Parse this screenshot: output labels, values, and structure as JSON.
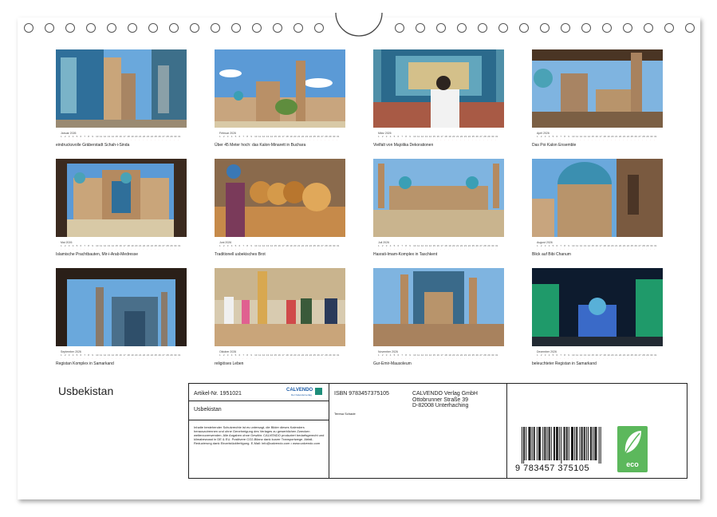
{
  "calendar_title": "Usbekistan",
  "months": [
    {
      "name": "Januar 2026",
      "caption": "eindrucksvolle Gräberstadt Schah-i-Sinda"
    },
    {
      "name": "Februar 2026",
      "caption": "Über 45 Meter hoch: das Kalon-Minarett in Buchara"
    },
    {
      "name": "März 2026",
      "caption": "Vielfalt von Majolika Dekorationen"
    },
    {
      "name": "April 2026",
      "caption": "Das Poi Kalon Ensemble"
    },
    {
      "name": "Mai 2026",
      "caption": "Islamische Prachtbauten, Mir-i-Arab-Medresse"
    },
    {
      "name": "Juni 2026",
      "caption": "Traditionell usbekisches Brot"
    },
    {
      "name": "Juli 2026",
      "caption": "Hasrati-Imam-Komplex in Taschkent"
    },
    {
      "name": "August 2026",
      "caption": "Blick auf Bibi Chanum"
    },
    {
      "name": "September 2026",
      "caption": "Registan Komplex in Samarkand"
    },
    {
      "name": "Oktober 2026",
      "caption": "religiöses Leben"
    },
    {
      "name": "November 2026",
      "caption": "Gur-Emir-Mausoleum"
    },
    {
      "name": "Dezember 2026",
      "caption": "beleuchteter Registan in Samarkand"
    }
  ],
  "info_box": {
    "article_number": "Artikel-Nr. 1951021",
    "brand": "CALVENDO",
    "brand_tagline": "Der Kalenderverlag",
    "short_title": "Usbekistan",
    "legal_text": "Inhalte bestehender Schutzrechte ist es untersagt, die Bilder dieses Kalenders herauszutrennen und ohne Genehmigung des Verlages zu gewerblichen Zwecken weiterzuverwenden. Alle Angaben ohne Gewähr. CALVENDO produziert bedarfsgerecht und klimabewusst in DE & EU. Positivere CO2-Bilanz dank kurzer Transportwege. Abfall-Reduzierung dank Einzelstückfertigung. E-Mail: info@calvendo.com • www.calvendo.com",
    "isbn": "ISBN 9783457375105",
    "publisher_name": "CALVENDO Verlag GmbH",
    "publisher_street": "Ottobrunner Straße 39",
    "publisher_city": "D-82008 Unterhaching",
    "author": "Teresa Schade",
    "barcode_number": "9 783457 375105",
    "eco_label": "eco"
  },
  "colors": {
    "sky": "#6aa8dc",
    "tile_blue": "#2f6f9a",
    "sandstone": "#c9a57a",
    "eco_green": "#5cb85c",
    "brand_blue": "#1a5aa6"
  }
}
